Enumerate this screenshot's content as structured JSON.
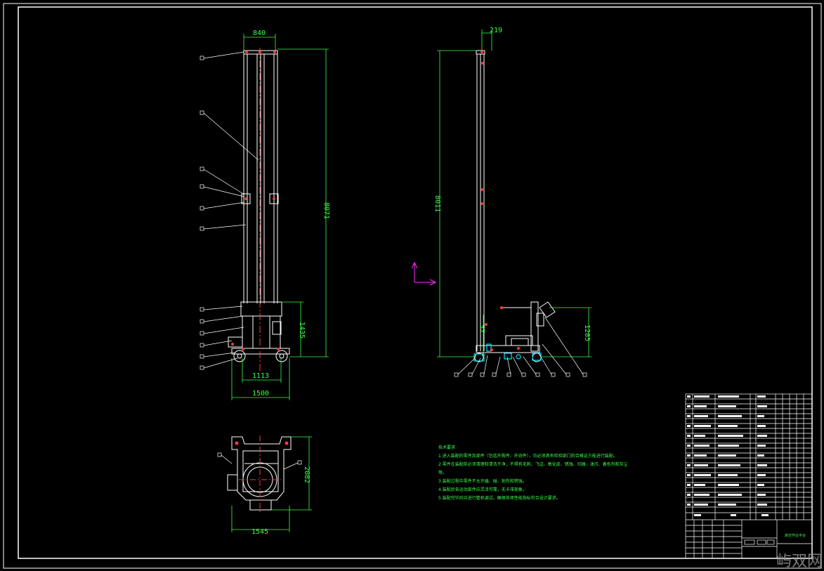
{
  "dimensions": {
    "front_width_top": "840",
    "front_height": "8071",
    "front_lower_height": "1435",
    "front_base_inner": "1113",
    "front_base_outer": "1500",
    "side_top_width": "219",
    "side_height": "8011",
    "side_right_height": "1285",
    "side_ground_offset": "57",
    "plan_width": "1545",
    "plan_height": "2082"
  },
  "notes": {
    "heading": "技术要求",
    "lines": [
      "1.进入装配的零件及部件（包括外购件、外协件），均必须具有检验部门的合格证方能进行装配。",
      "2.零件在装配前必须清理和清洗干净，不得有毛刺、飞边、氧化皮、锈蚀、切屑、油污、着色剂和灰尘",
      "等。",
      "3.装配过程中零件不允许磕、碰、划伤和锈蚀。",
      "4.装配后各运动部件应灵活可靠，无卡滞现象。",
      "5.装配完毕后应进行整机调试，确保各项性能指标符合设计要求。"
    ]
  },
  "title_block": {
    "name": "高空作业平台"
  },
  "watermark": "屿双网",
  "colors": {
    "background": "#000000",
    "outline": "#ffffff",
    "dimension": "#39ff4a",
    "center": "#ff3b3b",
    "hatch": "#00e5ff",
    "ucs": "#ff33ff"
  }
}
